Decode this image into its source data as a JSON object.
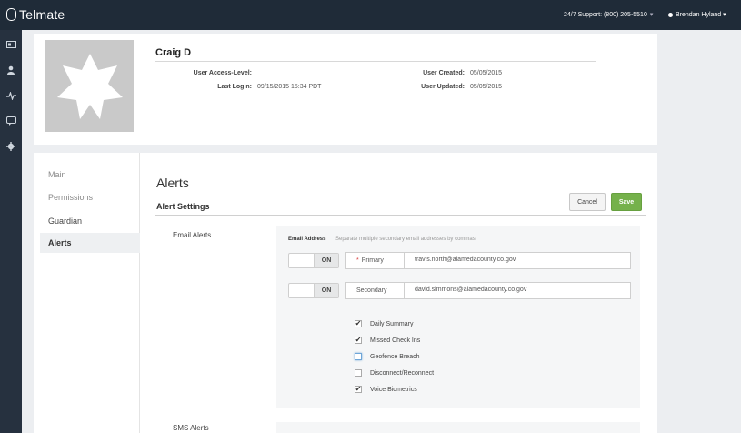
{
  "topbar": {
    "logo_text": "Telmate",
    "support_text": "24/7 Support: (800) 205-5510",
    "user_name": "Brendan Hyland"
  },
  "sidenav": {
    "icons": [
      "id-card-icon",
      "user-icon",
      "activity-icon",
      "chat-icon",
      "gear-icon"
    ]
  },
  "profile": {
    "name": "Craig D",
    "access_level_label": "User Access-Level:",
    "access_level_value": "",
    "last_login_label": "Last Login:",
    "last_login_value": "09/15/2015 15:34 PDT",
    "created_label": "User Created:",
    "created_value": "05/05/2015",
    "updated_label": "User Updated:",
    "updated_value": "05/05/2015"
  },
  "menu": {
    "items": [
      "Main",
      "Permissions",
      "Guardian",
      "Alerts"
    ]
  },
  "alerts": {
    "title": "Alerts",
    "section_title": "Alert Settings",
    "cancel_label": "Cancel",
    "save_label": "Save",
    "email_alerts_label": "Email Alerts",
    "email_address_label": "Email Address",
    "email_hint": "Separate multiple secondary email addresses by commas.",
    "primary": {
      "toggle": "ON",
      "required_mark": "*",
      "type": "Primary",
      "email": "travis.north@alamedacounty.co.gov"
    },
    "secondary": {
      "toggle": "ON",
      "type": "Secondary",
      "email": "david.simmons@alamedacounty.co.gov"
    },
    "checkboxes": [
      {
        "label": "Daily Summary",
        "checked": true
      },
      {
        "label": "Missed Check Ins",
        "checked": true
      },
      {
        "label": "Geofence Breach",
        "checked": false
      },
      {
        "label": "Disconnect/Reconnect",
        "checked": false
      },
      {
        "label": "Voice Biometrics",
        "checked": true
      }
    ],
    "sms_alerts_label": "SMS Alerts"
  },
  "colors": {
    "topbar": "#1f2b38",
    "sidenav": "#26313f",
    "save_green": "#75b14b"
  }
}
